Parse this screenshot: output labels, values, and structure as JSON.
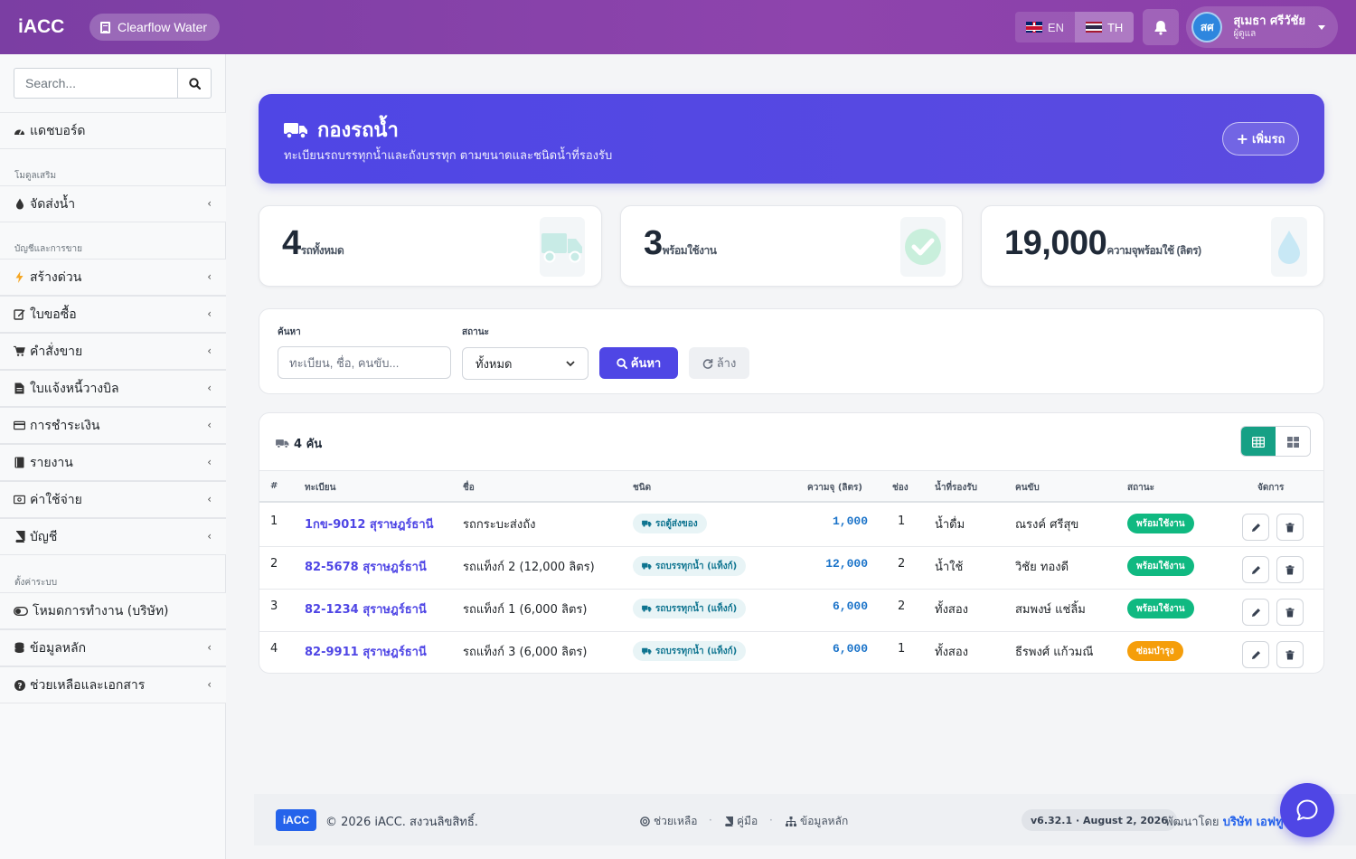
{
  "app": {
    "brand": "iACC",
    "company": "Clearflow Water"
  },
  "topbar": {
    "lang_en": "EN",
    "lang_th": "TH",
    "active_lang": "TH",
    "user": {
      "initials": "สศ",
      "name": "สุเมธา ศรีวัชัย",
      "role": "ผู้ดูแล"
    }
  },
  "sidebar": {
    "search_placeholder": "Search...",
    "dashboard": "แดชบอร์ด",
    "section_addons": "โมดูลเสริม",
    "water_delivery": "จัดส่งน้ำ",
    "section_accounting": "บัญชีและการขาย",
    "items": [
      {
        "label": "สร้างด่วน",
        "icon": "bolt-icon"
      },
      {
        "label": "ใบขอซื้อ",
        "icon": "edit-icon"
      },
      {
        "label": "คำสั่งขาย",
        "icon": "cart-icon"
      },
      {
        "label": "ใบแจ้งหนี้วางบิล",
        "icon": "file-icon"
      },
      {
        "label": "การชำระเงิน",
        "icon": "credit-card-icon"
      },
      {
        "label": "รายงาน",
        "icon": "book-icon"
      },
      {
        "label": "ค่าใช้จ่าย",
        "icon": "money-icon"
      },
      {
        "label": "บัญชี",
        "icon": "ledger-icon"
      }
    ],
    "section_settings": "ตั้งค่าระบบ",
    "settings_items": [
      {
        "label": "โหมดการทำงาน (บริษัท)",
        "icon": "toggle-icon"
      },
      {
        "label": "ข้อมูลหลัก",
        "icon": "database-icon"
      },
      {
        "label": "ช่วยเหลือและเอกสาร",
        "icon": "question-icon"
      }
    ]
  },
  "hero": {
    "title": "กองรถน้ำ",
    "subtitle": "ทะเบียนรถบรรทุกน้ำและถังบรรทุก ตามขนาดและชนิดน้ำที่รองรับ",
    "add_button": "เพิ่มรถ"
  },
  "stats": [
    {
      "value": "4",
      "label": "รถทั้งหมด",
      "icon": "truck-icon"
    },
    {
      "value": "3",
      "label": "พร้อมใช้งาน",
      "icon": "check-circle-icon"
    },
    {
      "value": "19,000",
      "label": "ความจุพร้อมใช้ (ลิตร)",
      "icon": "droplet-icon"
    }
  ],
  "filter": {
    "search_label": "ค้นหา",
    "search_placeholder": "ทะเบียน, ชื่อ, คนขับ...",
    "status_label": "สถานะ",
    "status_value": "ทั้งหมด",
    "search_button": "ค้นหา",
    "clear_button": "ล้าง"
  },
  "table": {
    "count_label": "4 คัน",
    "headers": [
      "#",
      "ทะเบียน",
      "ชื่อ",
      "ชนิด",
      "ความจุ (ลิตร)",
      "ช่อง",
      "น้ำที่รองรับ",
      "คนขับ",
      "สถานะ",
      "จัดการ"
    ],
    "rows": [
      {
        "no": "1",
        "plate": "1กข-9012 สุราษฎร์ธานี",
        "name": "รถกระบะส่งถัง",
        "type": "รถตู้ส่งของ",
        "capacity": "1,000",
        "compartments": "1",
        "water": "น้ำดื่ม",
        "driver": "ณรงค์ ศรีสุข",
        "status": "พร้อมใช้งาน",
        "status_color": "#10b981"
      },
      {
        "no": "2",
        "plate": "82-5678 สุราษฎร์ธานี",
        "name": "รถแท็งก์ 2 (12,000 ลิตร)",
        "type": "รถบรรทุกน้ำ (แท็งก์)",
        "capacity": "12,000",
        "compartments": "2",
        "water": "น้ำใช้",
        "driver": "วิชัย ทองดี",
        "status": "พร้อมใช้งาน",
        "status_color": "#10b981"
      },
      {
        "no": "3",
        "plate": "82-1234 สุราษฎร์ธานี",
        "name": "รถแท็งก์ 1 (6,000 ลิตร)",
        "type": "รถบรรทุกน้ำ (แท็งก์)",
        "capacity": "6,000",
        "compartments": "2",
        "water": "ทั้งสอง",
        "driver": "สมพงษ์ แช่ลิ้ม",
        "status": "พร้อมใช้งาน",
        "status_color": "#10b981"
      },
      {
        "no": "4",
        "plate": "82-9911 สุราษฎร์ธานี",
        "name": "รถแท็งก์ 3 (6,000 ลิตร)",
        "type": "รถบรรทุกน้ำ (แท็งก์)",
        "capacity": "6,000",
        "compartments": "1",
        "water": "ทั้งสอง",
        "driver": "ธีรพงศ์ แก้วมณี",
        "status": "ซ่อมบำรุง",
        "status_color": "#f59e0b"
      }
    ]
  },
  "footer": {
    "logo": "iACC",
    "copyright": "© 2026 iACC. สงวนลิขสิทธิ์.",
    "help": "ช่วยเหลือ",
    "manual": "คู่มือ",
    "master_data": "ข้อมูลหลัก",
    "version": "v6.32.1 · August 2, 2026",
    "developed_by": "พัฒนาโดย",
    "developer": "บริษัท เอฟทู"
  },
  "colors": {
    "primary": "#4f46e5",
    "topbar": "#8e44ad",
    "success": "#10b981",
    "warning": "#f59e0b",
    "teal": "#16a085"
  }
}
